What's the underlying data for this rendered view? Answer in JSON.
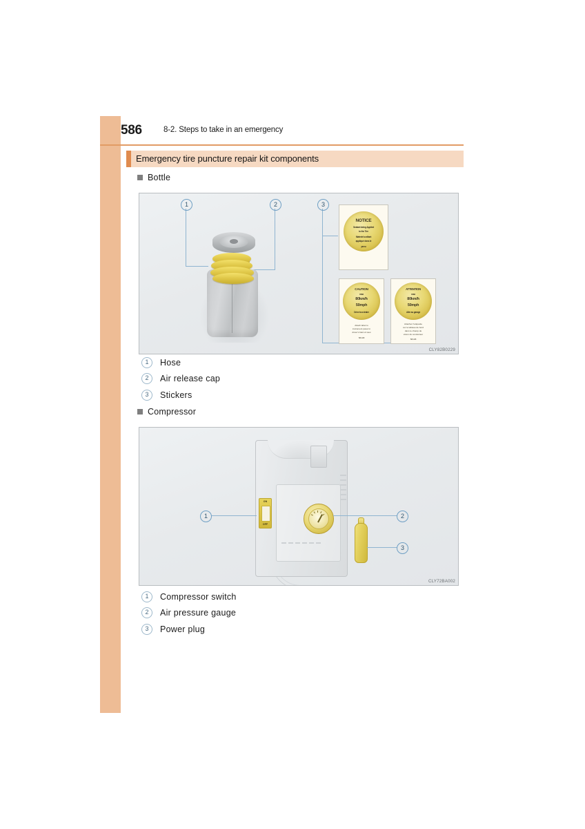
{
  "header": {
    "page_number": "586",
    "chapter": "8-2. Steps to take in an emergency"
  },
  "section": {
    "title": "Emergency tire puncture repair kit components"
  },
  "bottle_section": {
    "heading": "Bottle",
    "figure_code": "CLY82B0229",
    "callouts": [
      "1",
      "2",
      "3"
    ],
    "captions": [
      {
        "num": "1",
        "label": "Hose"
      },
      {
        "num": "2",
        "label": "Air release cap"
      },
      {
        "num": "3",
        "label": "Stickers"
      }
    ],
    "stickers": {
      "notice": {
        "title": "NOTICE",
        "lines": [
          "Sealant being Applied",
          "to the Tire",
          "Materiel scellant",
          "appliqué dans le",
          "pneu"
        ]
      },
      "caution": {
        "title": "CAUTION",
        "max_label": "max",
        "speed_kmh": "80km/h",
        "speed_mph": "50mph",
        "sub": "Drive to a dealer",
        "foot": [
          "Attach label to",
          "instrument panel in",
          "driver's field of view",
          "58108"
        ]
      },
      "attention": {
        "title": "ATTENTION",
        "max_label": "max",
        "speed_kmh": "80km/h",
        "speed_mph": "50mph",
        "sub": "Aller au garage",
        "foot": [
          "Attachez l'etiquette",
          "sur le tableau de bord",
          "dans le champ de",
          "vision du conducteur",
          "58108"
        ]
      }
    }
  },
  "compressor_section": {
    "heading": "Compressor",
    "figure_code": "CLY72BA002",
    "callouts": [
      "1",
      "2",
      "3"
    ],
    "switch_labels": {
      "on": "ON",
      "off": "OFF"
    },
    "captions": [
      {
        "num": "1",
        "label": "Compressor switch"
      },
      {
        "num": "2",
        "label": "Air pressure gauge"
      },
      {
        "num": "3",
        "label": "Power plug"
      }
    ]
  },
  "colors": {
    "edge_tab": "#eebc95",
    "header_rule": "#e29b64",
    "title_bar_bg": "#f6d9c2",
    "title_bar_accent": "#e08b4e",
    "callout_line": "#8fb4d0",
    "figure_bg": "#e9ecee"
  }
}
